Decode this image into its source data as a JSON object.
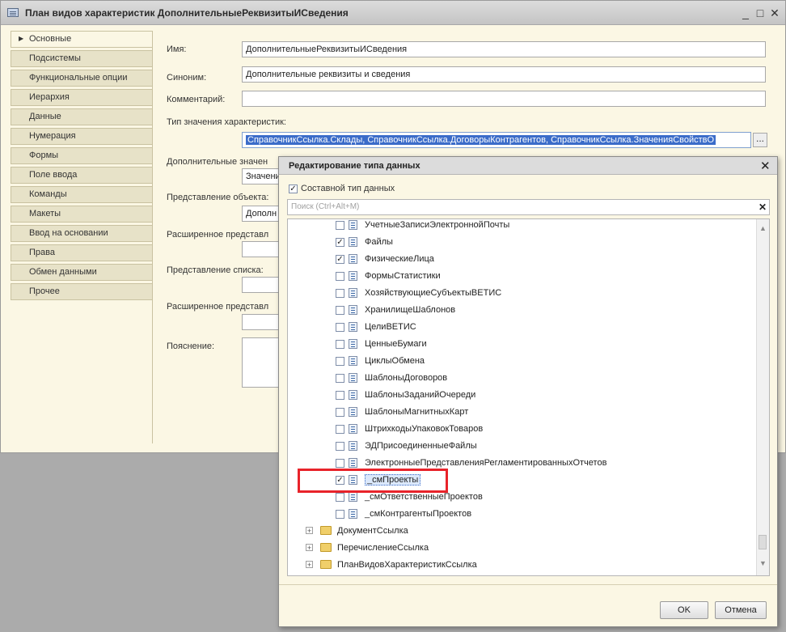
{
  "window": {
    "title": "План видов характеристик ДополнительныеРеквизитыИСведения",
    "min_glyph": "_",
    "max_glyph": "□",
    "close_glyph": "✕"
  },
  "sidebar": {
    "items": [
      {
        "label": "Основные"
      },
      {
        "label": "Подсистемы"
      },
      {
        "label": "Функциональные опции"
      },
      {
        "label": "Иерархия"
      },
      {
        "label": "Данные"
      },
      {
        "label": "Нумерация"
      },
      {
        "label": "Формы"
      },
      {
        "label": "Поле ввода"
      },
      {
        "label": "Команды"
      },
      {
        "label": "Макеты"
      },
      {
        "label": "Ввод на основании"
      },
      {
        "label": "Права"
      },
      {
        "label": "Обмен данными"
      },
      {
        "label": "Прочее"
      }
    ]
  },
  "form": {
    "name_label": "Имя:",
    "name_value": "ДополнительныеРеквизитыИСведения",
    "synonym_label": "Синоним:",
    "synonym_value": "Дополнительные реквизиты и сведения",
    "comment_label": "Комментарий:",
    "comment_value": "",
    "type_label": "Тип значения характеристик:",
    "type_value": "СправочникСсылка.Склады, СправочникСсылка.ДоговорыКонтрагентов, СправочникСсылка.ЗначенияСвойствО",
    "type_button": "...",
    "extra_values_label": "Дополнительные значен",
    "extra_values_value": "Значени",
    "object_repr_label": "Представление объекта:",
    "object_repr_value": "Дополн",
    "ext_repr_label": "Расширенное представл",
    "list_repr_label": "Представление списка:",
    "ext_repr2_label": "Расширенное представл",
    "explanation_label": "Пояснение:"
  },
  "dialog": {
    "title": "Редактирование типа данных",
    "close_glyph": "✕",
    "composite_label": "Составной тип данных",
    "composite_checked": true,
    "search_placeholder": "Поиск (Ctrl+Alt+M)",
    "search_clear": "✕",
    "items": [
      {
        "name": "УчетныеЗаписиЭлектроннойПочты",
        "checked": false
      },
      {
        "name": "Файлы",
        "checked": true
      },
      {
        "name": "ФизическиеЛица",
        "checked": true
      },
      {
        "name": "ФормыСтатистики",
        "checked": false
      },
      {
        "name": "ХозяйствующиеСубъектыВЕТИС",
        "checked": false
      },
      {
        "name": "ХранилищеШаблонов",
        "checked": false
      },
      {
        "name": "ЦелиВЕТИС",
        "checked": false
      },
      {
        "name": "ЦенныеБумаги",
        "checked": false
      },
      {
        "name": "ЦиклыОбмена",
        "checked": false
      },
      {
        "name": "ШаблоныДоговоров",
        "checked": false
      },
      {
        "name": "ШаблоныЗаданийОчереди",
        "checked": false
      },
      {
        "name": "ШаблоныМагнитныхКарт",
        "checked": false
      },
      {
        "name": "ШтрихкодыУпаковокТоваров",
        "checked": false
      },
      {
        "name": "ЭДПрисоединенныеФайлы",
        "checked": false
      },
      {
        "name": "ЭлектронныеПредставленияРегламентированныхОтчетов",
        "checked": false
      },
      {
        "name": "_смПроекты",
        "checked": true
      },
      {
        "name": "_смОтветственныеПроектов",
        "checked": false
      },
      {
        "name": "_смКонтрагентыПроектов",
        "checked": false
      }
    ],
    "groups": [
      {
        "name": "ДокументСсылка"
      },
      {
        "name": "ПеречислениеСсылка"
      },
      {
        "name": "ПланВидовХарактеристикСсылка"
      }
    ],
    "check_glyph": "✓",
    "expand_glyph": "+",
    "ok_label": "OK",
    "cancel_label": "Отмена"
  },
  "colors": {
    "highlight_box": "#e8232a",
    "selection": "#3b6cc9"
  }
}
